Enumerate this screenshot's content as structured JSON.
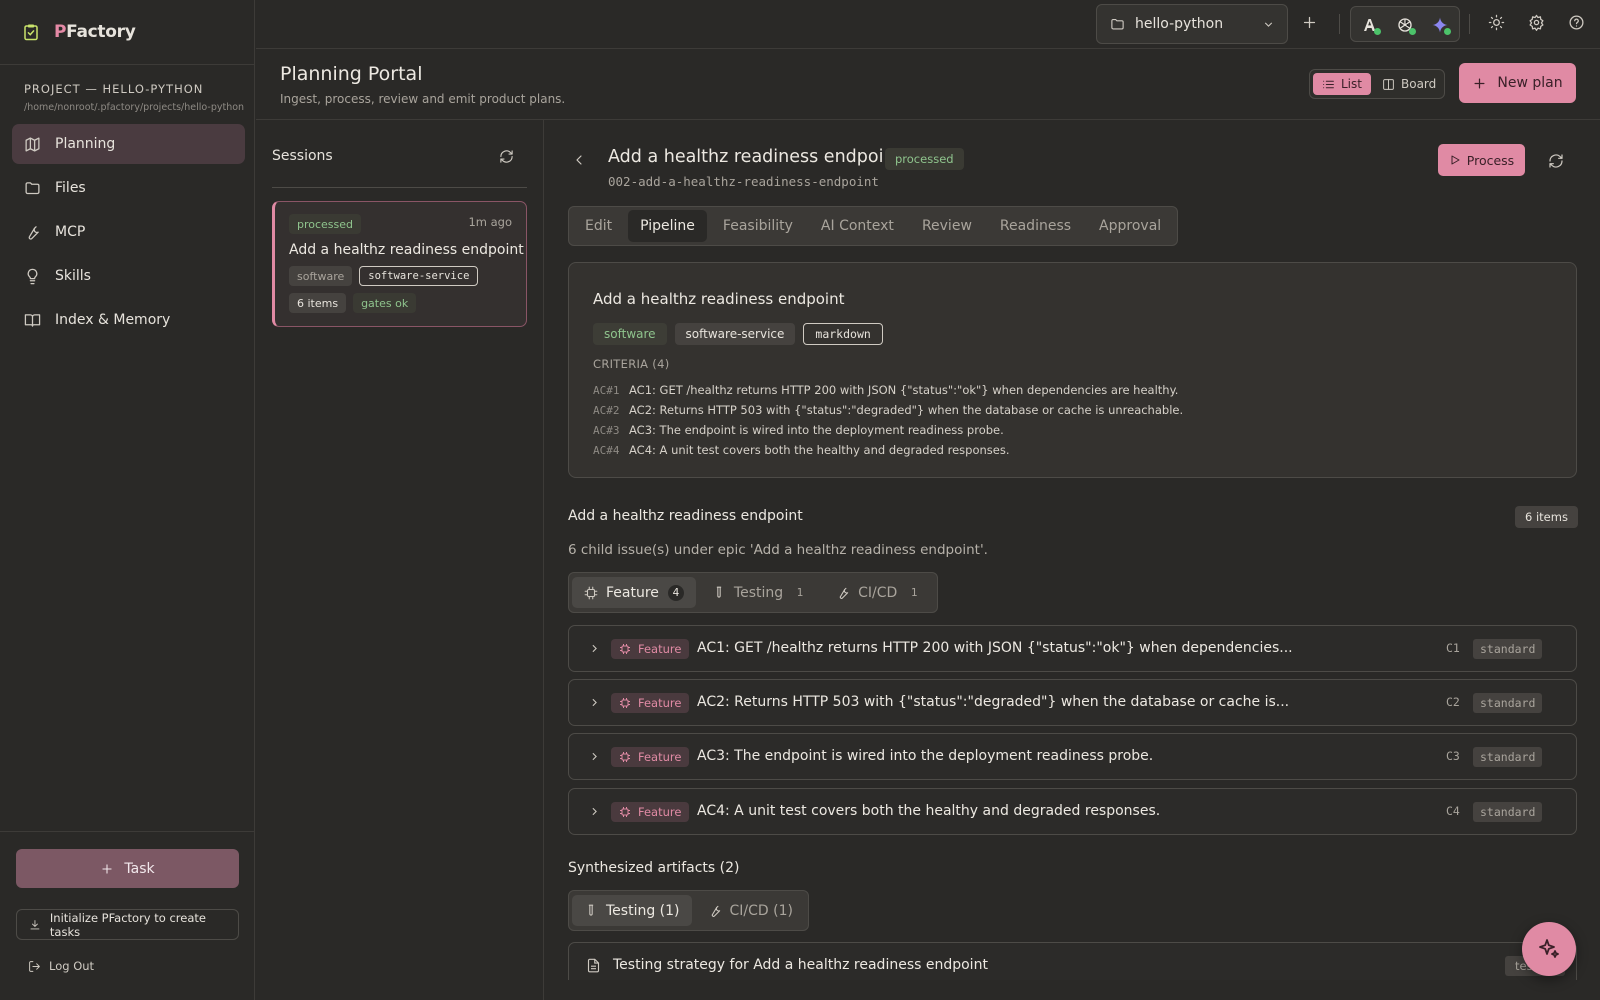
{
  "brand": {
    "initial": "P",
    "rest": "Factory"
  },
  "sidebar": {
    "project_label": "PROJECT — HELLO-PYTHON",
    "project_path": "/home/nonroot/.pfactory/projects/hello-python",
    "items": [
      {
        "label": "Planning",
        "icon": "map-icon"
      },
      {
        "label": "Files",
        "icon": "folder-icon"
      },
      {
        "label": "MCP",
        "icon": "wrench-icon"
      },
      {
        "label": "Skills",
        "icon": "lightbulb-icon"
      },
      {
        "label": "Index & Memory",
        "icon": "book-icon"
      }
    ],
    "task_label": "Task",
    "init_label": "Initialize PFactory to create tasks",
    "logout_label": "Log Out"
  },
  "topbar": {
    "project_select": "hello-python"
  },
  "header": {
    "title": "Planning Portal",
    "subtitle": "Ingest, process, review and emit product plans.",
    "view_list": "List",
    "view_board": "Board",
    "new_plan": "New plan"
  },
  "sessions": {
    "title": "Sessions",
    "card": {
      "status": "processed",
      "time": "1m ago",
      "title": "Add a healthz readiness endpoint",
      "tags": [
        "software",
        "software-service"
      ],
      "items": "6 items",
      "gates": "gates ok"
    }
  },
  "plan": {
    "title": "Add a healthz readiness endpoint",
    "status": "processed",
    "slug": "002-add-a-healthz-readiness-endpoint",
    "process_label": "Process",
    "tabs": [
      "Edit",
      "Pipeline",
      "Feasibility",
      "AI Context",
      "Review",
      "Readiness",
      "Approval"
    ],
    "active_tab": "Pipeline",
    "card": {
      "title": "Add a healthz readiness endpoint",
      "tags": [
        "software",
        "software-service",
        "markdown"
      ],
      "criteria_label": "CRITERIA (4)",
      "criteria": [
        {
          "id": "AC#1",
          "text": "AC1: GET /healthz returns HTTP 200 with JSON {\"status\":\"ok\"} when dependencies are healthy."
        },
        {
          "id": "AC#2",
          "text": "AC2: Returns HTTP 503 with {\"status\":\"degraded\"} when the database or cache is unreachable."
        },
        {
          "id": "AC#3",
          "text": "AC3: The endpoint is wired into the deployment readiness probe."
        },
        {
          "id": "AC#4",
          "text": "AC4: A unit test covers both the healthy and degraded responses."
        }
      ]
    },
    "epic": {
      "title": "Add a healthz readiness endpoint",
      "count": "6 items",
      "description": "6 child issue(s) under epic 'Add a healthz readiness endpoint'.",
      "categories": [
        {
          "label": "Feature",
          "count": "4",
          "icon": "chip-icon"
        },
        {
          "label": "Testing",
          "count": "1",
          "icon": "test-tube-icon"
        },
        {
          "label": "CI/CD",
          "count": "1",
          "icon": "wrench-icon"
        }
      ],
      "issues": [
        {
          "tag": "Feature",
          "text": "AC1: GET /healthz returns HTTP 200 with JSON {\"status\":\"ok\"} when dependencies...",
          "id": "C1",
          "size": "standard"
        },
        {
          "tag": "Feature",
          "text": "AC2: Returns HTTP 503 with {\"status\":\"degraded\"} when the database or cache is...",
          "id": "C2",
          "size": "standard"
        },
        {
          "tag": "Feature",
          "text": "AC3: The endpoint is wired into the deployment readiness probe.",
          "id": "C3",
          "size": "standard"
        },
        {
          "tag": "Feature",
          "text": "AC4: A unit test covers both the healthy and degraded responses.",
          "id": "C4",
          "size": "standard"
        }
      ]
    },
    "artifacts": {
      "title": "Synthesized artifacts (2)",
      "tabs": [
        "Testing (1)",
        "CI/CD (1)"
      ],
      "row": {
        "text": "Testing strategy for Add a healthz readiness endpoint",
        "tag": "testing"
      }
    }
  },
  "colors": {
    "accent": "#e08aa4",
    "status_ok": "#4cc36a",
    "background": "#2a2927"
  }
}
